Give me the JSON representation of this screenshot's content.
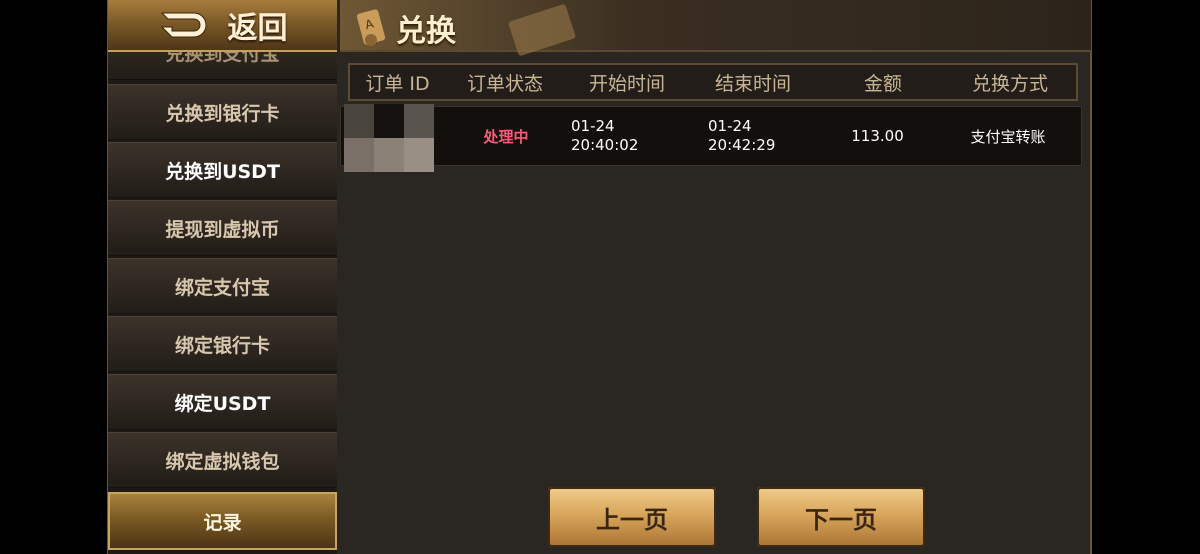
{
  "header": {
    "back_label": "返回",
    "title": "兑换"
  },
  "sidebar": {
    "items": [
      {
        "label": "兑换到支付宝"
      },
      {
        "label": "兑换到银行卡"
      },
      {
        "label": "兑换到USDT"
      },
      {
        "label": "提现到虚拟币"
      },
      {
        "label": "绑定支付宝"
      },
      {
        "label": "绑定银行卡"
      },
      {
        "label": "绑定USDT"
      },
      {
        "label": "绑定虚拟钱包"
      },
      {
        "label": "记录"
      }
    ]
  },
  "table": {
    "columns": [
      "订单 ID",
      "订单状态",
      "开始时间",
      "结束时间",
      "金额",
      "兑换方式"
    ],
    "rows": [
      {
        "order_id": "",
        "status": "处理中",
        "start_date": "01-24",
        "start_time": "20:40:02",
        "end_date": "01-24",
        "end_time": "20:42:29",
        "amount": "113.00",
        "method": "支付宝转账"
      }
    ]
  },
  "pager": {
    "prev_label": "上一页",
    "next_label": "下一页"
  },
  "colors": {
    "accent_gold": "#d9a65d",
    "status_pending": "#ff5a78"
  }
}
